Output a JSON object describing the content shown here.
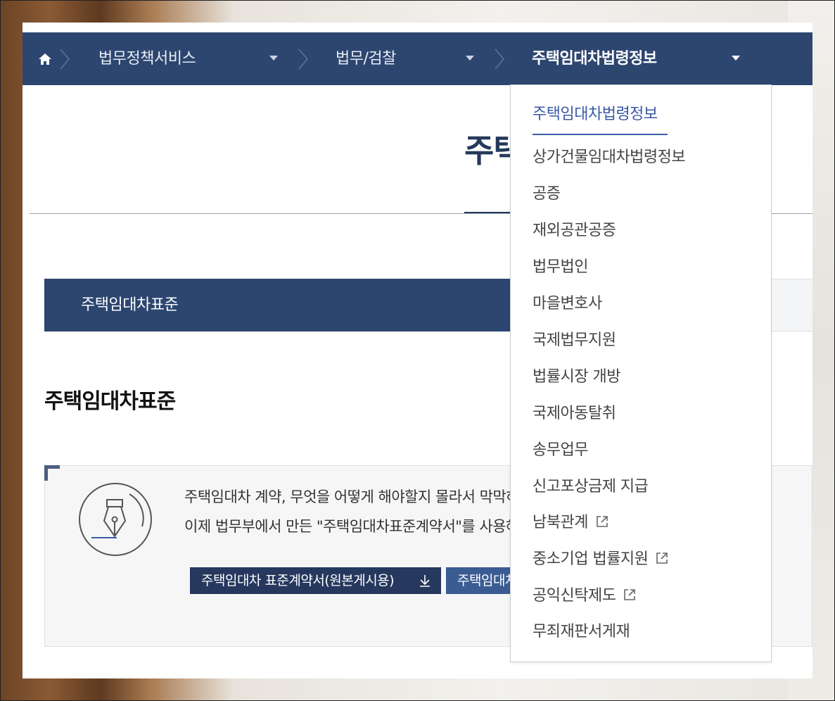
{
  "breadcrumb": {
    "home_icon": "home-icon",
    "level1": "법무정책서비스",
    "level2": "법무/검찰",
    "level3": "주택임대차법령정보"
  },
  "page": {
    "title": "주택임대차법령정보"
  },
  "tabs": {
    "active": "주택임대차표준"
  },
  "section": {
    "title": "주택임대차표준"
  },
  "info": {
    "icon": "fountain-pen-icon",
    "line1": "주택임대차 계약, 무엇을 어떻게 해야할지 몰라서 막막하셨나요?",
    "line2": "이제 법무부에서 만든 \"주택임대차표준계약서\"를 사용해보세요.",
    "button1": "주택임대차 표준계약서(원본게시용)",
    "button2": "주택임대차 표준계약서"
  },
  "dropdown": {
    "items": [
      {
        "label": "주택임대차법령정보",
        "selected": true,
        "external": false
      },
      {
        "label": "상가건물임대차법령정보",
        "selected": false,
        "external": false
      },
      {
        "label": "공증",
        "selected": false,
        "external": false
      },
      {
        "label": "재외공관공증",
        "selected": false,
        "external": false
      },
      {
        "label": "법무법인",
        "selected": false,
        "external": false
      },
      {
        "label": "마을변호사",
        "selected": false,
        "external": false
      },
      {
        "label": "국제법무지원",
        "selected": false,
        "external": false
      },
      {
        "label": "법률시장 개방",
        "selected": false,
        "external": false
      },
      {
        "label": "국제아동탈취",
        "selected": false,
        "external": false
      },
      {
        "label": "송무업무",
        "selected": false,
        "external": false
      },
      {
        "label": "신고포상금제 지급",
        "selected": false,
        "external": false
      },
      {
        "label": "남북관계",
        "selected": false,
        "external": true
      },
      {
        "label": "중소기업 법률지원",
        "selected": false,
        "external": true
      },
      {
        "label": "공익신탁제도",
        "selected": false,
        "external": true
      },
      {
        "label": "무죄재판서게재",
        "selected": false,
        "external": false
      }
    ]
  },
  "colors": {
    "navy": "#2d4670",
    "accent": "#3a5aa6"
  }
}
